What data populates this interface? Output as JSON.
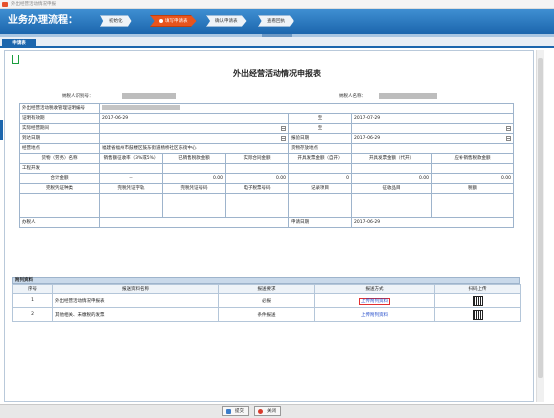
{
  "window": {
    "title": "外出经营活动情况申报"
  },
  "banner": {
    "title": "业务办理流程：",
    "steps": [
      "初始化",
      "填写申请表",
      "确认申请表",
      "查看回执"
    ],
    "active_step": 1
  },
  "tabs": [
    "申请表"
  ],
  "form": {
    "title": "外出经营活动情况申报表",
    "taxpayer_id_label": "纳税人识别号：",
    "taxpayer_name_label": "纳税人名称：",
    "rows": {
      "cert_no_label": "外出经营活动税收管理证明编号",
      "valid_label": "证明有效期",
      "valid_from": "2017-06-29",
      "to_label": "至",
      "valid_to": "2017-07-29",
      "actual_period_label": "实际经营期间",
      "arrival_label": "到达日期",
      "report_date_label": "报验日期",
      "report_date": "2017-06-29",
      "place_label": "经营地点",
      "place_value": "福建省福州市鼓楼区鼓东街道杨桥社区东街中心",
      "goods_place_label": "货物存放地点"
    },
    "columns": [
      "货物（劳务）名称",
      "销售额征收率（3%或5%）",
      "已销售税款金额",
      "实际合同金额",
      "开具发票金额（自开）",
      "开具发票金额（代开）",
      "应补销售税款金额"
    ],
    "project_label": "工程开发",
    "total_label": "合计金额",
    "totals": [
      "--",
      "0.00",
      "0.00",
      "0",
      "0.00",
      "0.00"
    ],
    "voucher_headers": [
      "完税凭证种类",
      "完税凭证字轨",
      "完税凭证号码",
      "电子税票号码",
      "记录项目",
      "征收品目",
      "税额"
    ],
    "handler_label": "办税人",
    "apply_date_label": "申请日期",
    "apply_date": "2017-06-29"
  },
  "attachments": {
    "title": "附列资料",
    "headers": [
      "序号",
      "报送资料名称",
      "报送要求",
      "报送方式",
      "扫码上传"
    ],
    "rows": [
      {
        "no": "1",
        "name": "外出经营活动情况申报表",
        "req": "必报",
        "method": "上传附列资料"
      },
      {
        "no": "2",
        "name": "其他相关、未缴税的发票",
        "req": "条件报送",
        "method": "上传附列资料"
      }
    ]
  },
  "footer": {
    "submit": "提交",
    "close": "关闭"
  }
}
